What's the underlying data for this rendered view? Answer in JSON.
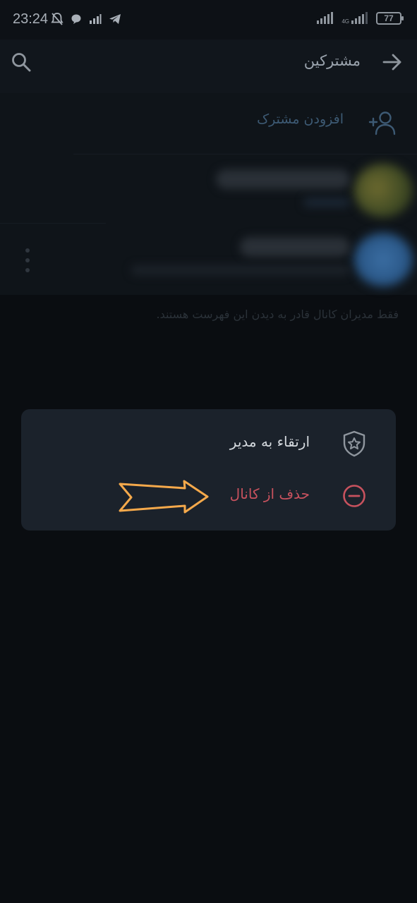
{
  "status": {
    "time": "23:24",
    "network": "4G",
    "battery": "77"
  },
  "header": {
    "title": "مشترکین"
  },
  "list": {
    "add_label": "افزودن مشترک",
    "footer_note": "فقط مدیران کانال قادر به دیدن این فهرست هستند."
  },
  "popup": {
    "items": [
      {
        "label": "ارتقاء به مدیر",
        "icon": "shield-star-icon"
      },
      {
        "label": "حذف از کانال",
        "icon": "minus-circle-icon"
      }
    ]
  },
  "colors": {
    "background": "#0a0d11",
    "popup_bg": "#1b222b",
    "danger": "#c8525e",
    "annotation_arrow": "#f5a94b",
    "accent_blue": "#3d5a74"
  }
}
